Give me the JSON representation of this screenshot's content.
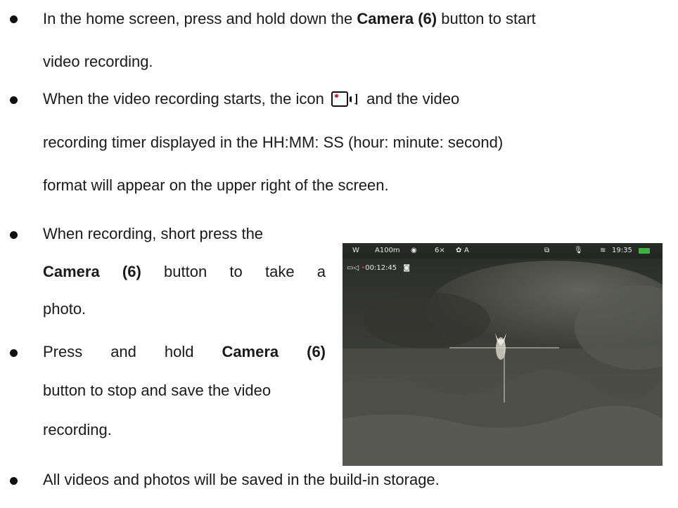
{
  "bullets": [
    {
      "lines": [
        {
          "pre": "In the home screen, press and hold down the ",
          "bold": "Camera (6)",
          "post": " button to start"
        },
        {
          "text": "video recording."
        }
      ]
    },
    {
      "lines": [
        {
          "pre": "When the video recording starts, the icon",
          "icon": "video-record-icon",
          "post": "and the video"
        },
        {
          "text": "recording timer displayed in the HH:MM: SS (hour: minute: second)"
        },
        {
          "text": "format will appear on the upper right of the screen."
        }
      ]
    },
    {
      "lines": [
        {
          "text": "When recording, short press the"
        },
        {
          "bold": "Camera (6)",
          "post": "button to take a"
        },
        {
          "text": "photo."
        }
      ]
    },
    {
      "lines": [
        {
          "pre": "Press and hold ",
          "bold": "Camera (6)"
        },
        {
          "text": "button to stop and save the video"
        },
        {
          "text": "recording."
        }
      ]
    },
    {
      "lines": [
        {
          "text": "All videos and photos will be saved in the build-in storage."
        }
      ]
    }
  ],
  "device_screen": {
    "status_bar": {
      "mode": "W",
      "range": "A100m",
      "zoom": "6×",
      "calibration": "A",
      "time": "19:35"
    },
    "recording_timer": "00:12:45",
    "icons": [
      "eye-icon",
      "calibration-icon",
      "screen-icon",
      "microphone-icon",
      "wifi-icon",
      "battery-icon",
      "video-icon",
      "camera-icon"
    ]
  }
}
